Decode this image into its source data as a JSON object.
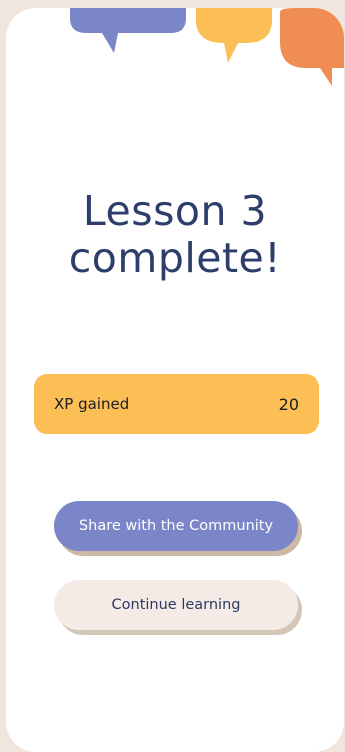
{
  "lesson": {
    "title_line1": "Lesson 3",
    "title_line2": "complete!"
  },
  "xp": {
    "label": "XP gained",
    "value": "20"
  },
  "buttons": {
    "share_label": "Share with the Community",
    "continue_label": "Continue learning"
  },
  "decor": {
    "bubble_colors": [
      "#7a86c7",
      "#fbbf55",
      "#ef8d55"
    ]
  },
  "colors": {
    "background": "#f0e6e0",
    "title": "#2d3e6b",
    "xp_card": "#fbbf55",
    "share_button": "#7a86c7",
    "continue_button": "#f4ebe6"
  }
}
